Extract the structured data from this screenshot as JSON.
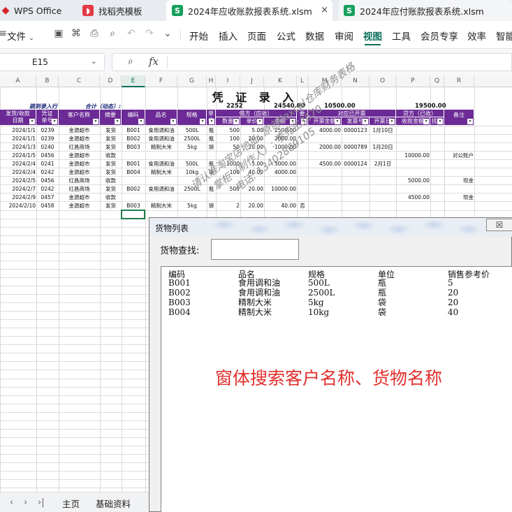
{
  "tabs": [
    {
      "label": "WPS Office",
      "icon": "wps-logo-icon",
      "color": "#d8242b"
    },
    {
      "label": "找稻壳模板",
      "icon": "docer-logo-icon",
      "color": "#e23a45"
    },
    {
      "label": "2024年应收账款报表系统.xlsm",
      "icon": "sheet-logo-icon",
      "color": "#17a05d",
      "close": "×"
    },
    {
      "label": "2024年应付账款报表系统.xlsm",
      "icon": "sheet-logo-icon",
      "color": "#17a05d"
    }
  ],
  "menubar": {
    "file": "文件",
    "items": [
      "开始",
      "插入",
      "页面",
      "公式",
      "数据",
      "审阅",
      "视图",
      "工具",
      "会员专享",
      "效率",
      "智能"
    ],
    "active": "视图",
    "accent": "#0d6e59"
  },
  "formula": {
    "cell_ref": "E15",
    "fx": "fx"
  },
  "columns": [
    "A",
    "B",
    "C",
    "D",
    "E",
    "F",
    "G",
    "H",
    "I",
    "J",
    "K",
    "L",
    "M",
    "N",
    "O",
    "P",
    "Q",
    "R"
  ],
  "selected_column": "E",
  "sheet_title": "凭 证 录 入",
  "summary": {
    "entry_label": "跳到录入行",
    "total_label": "合计（动态）:",
    "qty_total": "2252",
    "debit_total": "24540.00",
    "issued_total": "10500.00",
    "credit_total": "19500.00"
  },
  "group_headers": {
    "debit": "借方（应收）",
    "issued": "对应已开票",
    "credit": "贷方（已收）"
  },
  "headers": [
    "发货/收款日期",
    "凭证单号",
    "客户名称",
    "摘要",
    "编码",
    "品名",
    "规格",
    "单位",
    "数量",
    "单价",
    "金额",
    "要",
    "开票金额",
    "发票号",
    "开票日",
    "收款金额",
    "找零",
    "备注"
  ],
  "header_lines": {
    "A": [
      "发货/收款",
      "日期"
    ],
    "B": [
      "凭证",
      "单号"
    ],
    "H": [
      "单",
      "位"
    ],
    "L": [
      "要",
      ""
    ]
  },
  "header_color": "#6b2a95",
  "rows": [
    [
      "2024/1/1",
      "0239",
      "金源超市",
      "发货",
      "B001",
      "食用调和油",
      "500L",
      "瓶",
      "500",
      "5.00",
      "2500.00",
      "",
      "4000.00",
      "0000123",
      "1月10日",
      "",
      "",
      ""
    ],
    [
      "2024/1/1",
      "0239",
      "金源超市",
      "发货",
      "B002",
      "食用调和油",
      "2500L",
      "瓶",
      "100",
      "20.00",
      "2000.00",
      "",
      "",
      "",
      "",
      "",
      "",
      ""
    ],
    [
      "2024/1/3",
      "0240",
      "红昌商场",
      "发货",
      "B003",
      "精制大米",
      "5kg",
      "袋",
      "50",
      "20.00",
      "1000.00",
      "",
      "2000.00",
      "0000789",
      "1月20日",
      "",
      "",
      ""
    ],
    [
      "2024/1/5",
      "0456",
      "金源超市",
      "收款",
      "",
      "",
      "",
      "",
      "",
      "",
      "",
      "",
      "",
      "",
      "",
      "10000.00",
      "",
      "对公账户"
    ],
    [
      "2024/2/4",
      "0241",
      "金源超市",
      "发货",
      "B001",
      "食用调和油",
      "500L",
      "瓶",
      "1000",
      "5.00",
      "5000.00",
      "",
      "4500.00",
      "0000124",
      "2月1日",
      "",
      "",
      ""
    ],
    [
      "2024/2/4",
      "0242",
      "金源超市",
      "发货",
      "B004",
      "精制大米",
      "10kg",
      "袋",
      "100",
      "40.00",
      "4000.00",
      "",
      "",
      "",
      "",
      "",
      "",
      ""
    ],
    [
      "2024/2/5",
      "0456",
      "红昌商场",
      "收款",
      "",
      "",
      "",
      "",
      "",
      "",
      "",
      "",
      "",
      "",
      "",
      "5000.00",
      "",
      "现金"
    ],
    [
      "2024/2/7",
      "0242",
      "红昌商场",
      "发货",
      "B002",
      "食用调和油",
      "2500L",
      "瓶",
      "500",
      "20.00",
      "10000.00",
      "",
      "",
      "",
      "",
      "",
      "",
      ""
    ],
    [
      "2024/2/9",
      "0457",
      "金源超市",
      "收款",
      "",
      "",
      "",
      "",
      "",
      "",
      "",
      "",
      "",
      "",
      "",
      "4500.00",
      "",
      "现金"
    ],
    [
      "2024/2/10",
      "0458",
      "金源超市",
      "发货",
      "B003",
      "精制大米",
      "5kg",
      "袋",
      "2",
      "20.00",
      "40.00",
      "否",
      "",
      "",
      "",
      "",
      "",
      ""
    ]
  ],
  "sheet_tabs": [
    "主页",
    "基础资料"
  ],
  "dialog": {
    "title": "货物列表",
    "close": "☒",
    "search_label": "货物查找:",
    "search_value": "",
    "list_headers": [
      "编码",
      "品名",
      "规格",
      "单位",
      "销售参考价"
    ],
    "list_rows": [
      [
        "B001",
        "食用调和油",
        "500L",
        "瓶",
        "5"
      ],
      [
        "B002",
        "食用调和油",
        "2500L",
        "瓶",
        "20"
      ],
      [
        "B003",
        "精制大米",
        "5kg",
        "袋",
        "20"
      ],
      [
        "B004",
        "精制大米",
        "10kg",
        "袋",
        "40"
      ]
    ]
  },
  "promo_text": "窗体搜索客户名称、货物名称",
  "watermark": [
    "请认准淘宝店地址: 原创Eexcel仓库财务表格",
    "掌柜（制作人）: 李先生3670",
    "电话: 13402869105"
  ]
}
